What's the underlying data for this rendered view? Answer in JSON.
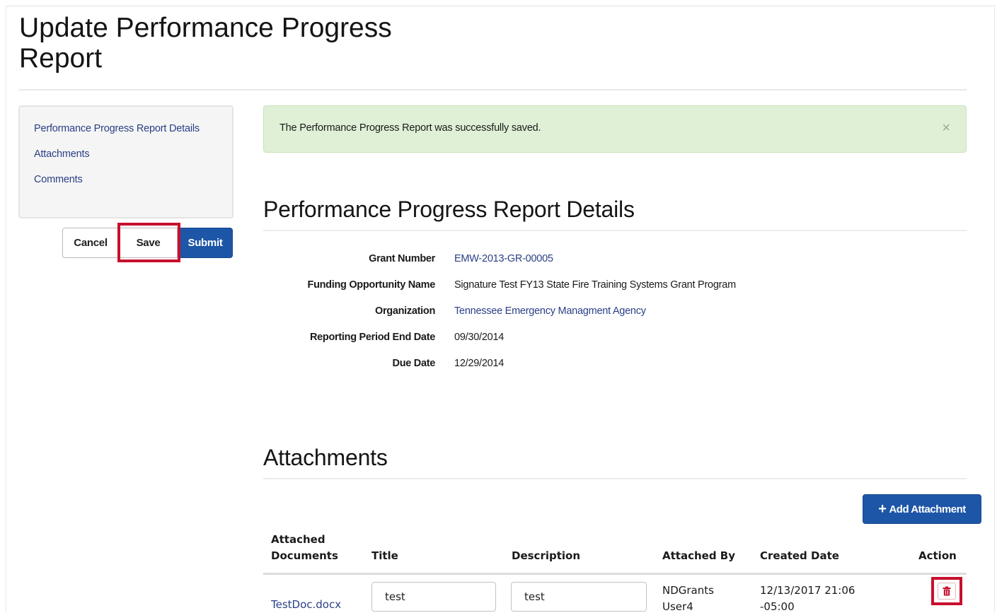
{
  "page": {
    "title": "Update Performance Progress Report"
  },
  "sidebar": {
    "items": [
      {
        "label": "Performance Progress Report Details"
      },
      {
        "label": "Attachments"
      },
      {
        "label": "Comments"
      }
    ]
  },
  "actions": {
    "cancel_label": "Cancel",
    "save_label": "Save",
    "submit_label": "Submit"
  },
  "alert": {
    "message": "The Performance Progress Report was successfully saved.",
    "close_glyph": "×"
  },
  "details": {
    "heading": "Performance Progress Report Details",
    "rows": [
      {
        "label": "Grant Number",
        "value": "EMW-2013-GR-00005"
      },
      {
        "label": "Funding Opportunity Name",
        "value": "Signature Test FY13 State Fire Training Systems Grant Program"
      },
      {
        "label": "Organization",
        "value": "Tennessee Emergency Managment Agency"
      },
      {
        "label": "Reporting Period End Date",
        "value": "09/30/2014"
      },
      {
        "label": "Due Date",
        "value": "12/29/2014"
      }
    ]
  },
  "attachments": {
    "heading": "Attachments",
    "add_label": "Add Attachment",
    "columns": {
      "documents_line1": "Attached",
      "documents_line2": "Documents",
      "title": "Title",
      "description": "Description",
      "attached_by": "Attached By",
      "created_date": "Created Date",
      "action": "Action"
    },
    "rows": [
      {
        "document": "TestDoc.docx",
        "title": "test",
        "description": "test",
        "attached_by_line1": "NDGrants",
        "attached_by_line2": "User4",
        "created_line1": "12/13/2017 21:06",
        "created_line2": "-05:00"
      }
    ]
  },
  "colors": {
    "primary_button": "#1d56a6",
    "highlight_box": "#c8102e",
    "success_alert": "#dff0d6",
    "link": "#2a3f86"
  },
  "icons": {
    "close": "close-icon",
    "plus": "plus-icon",
    "delete": "trash-icon"
  }
}
